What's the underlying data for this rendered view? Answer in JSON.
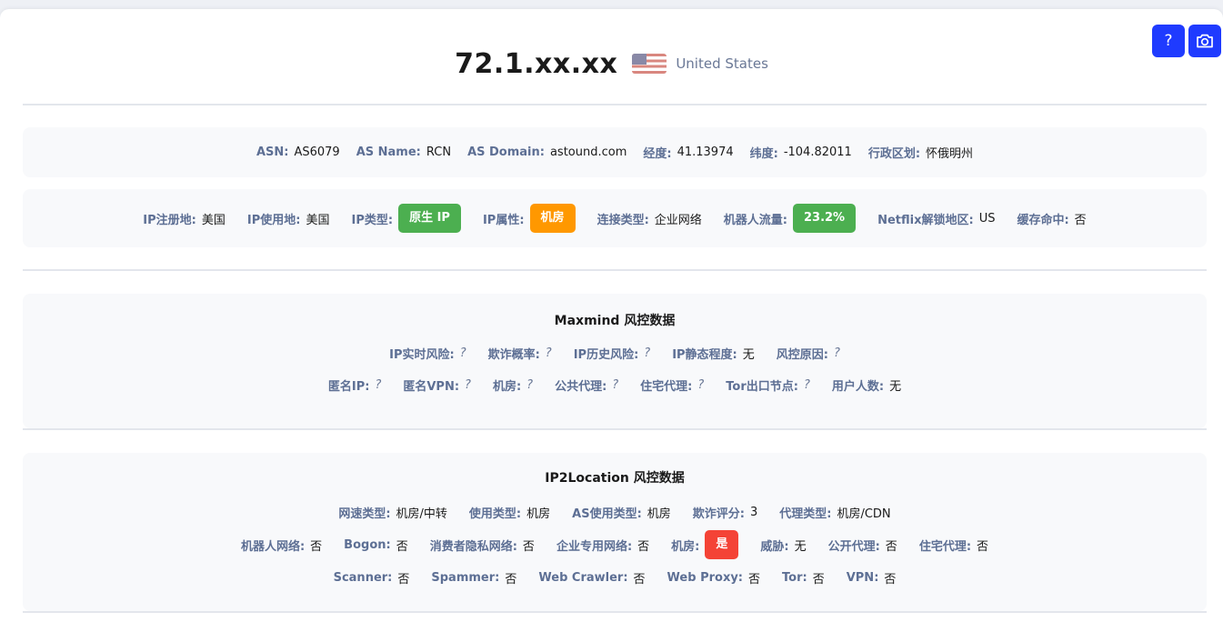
{
  "header": {
    "ip": "72.1.xx.xx",
    "country": "United States",
    "help_label": "?"
  },
  "summary_row1": [
    {
      "key": "ASN:",
      "value": "AS6079"
    },
    {
      "key": "AS Name:",
      "value": "RCN"
    },
    {
      "key": "AS Domain:",
      "value": "astound.com"
    },
    {
      "key": "经度:",
      "value": "41.13974"
    },
    {
      "key": "纬度:",
      "value": "-104.82011"
    },
    {
      "key": "行政区划:",
      "value": "怀俄明州"
    }
  ],
  "summary_row2": [
    {
      "key": "IP注册地:",
      "value": "美国"
    },
    {
      "key": "IP使用地:",
      "value": "美国"
    },
    {
      "key": "IP类型:",
      "badge": "原生 IP",
      "color": "#4caf50"
    },
    {
      "key": "IP属性:",
      "badge": "机房",
      "color": "#ff9800"
    },
    {
      "key": "连接类型:",
      "value": "企业网络"
    },
    {
      "key": "机器人流量:",
      "badge": "23.2%",
      "color": "#4caf50"
    },
    {
      "key": "Netflix解锁地区:",
      "value": "US"
    },
    {
      "key": "缓存命中:",
      "value": "否"
    }
  ],
  "maxmind": {
    "title": "Maxmind 风控数据",
    "row1": [
      {
        "key": "IP实时风险:",
        "value": "?"
      },
      {
        "key": "欺诈概率:",
        "value": "?"
      },
      {
        "key": "IP历史风险:",
        "value": "?"
      },
      {
        "key": "IP静态程度:",
        "value": "无"
      },
      {
        "key": "风控原因:",
        "value": "?"
      }
    ],
    "row2": [
      {
        "key": "匿名IP:",
        "value": "?"
      },
      {
        "key": "匿名VPN:",
        "value": "?"
      },
      {
        "key": "机房:",
        "value": "?"
      },
      {
        "key": "公共代理:",
        "value": "?"
      },
      {
        "key": "住宅代理:",
        "value": "?"
      },
      {
        "key": "Tor出口节点:",
        "value": "?"
      },
      {
        "key": "用户人数:",
        "value": "无"
      }
    ]
  },
  "ip2location": {
    "title": "IP2Location 风控数据",
    "row1": [
      {
        "key": "网速类型:",
        "value": "机房/中转"
      },
      {
        "key": "使用类型:",
        "value": "机房"
      },
      {
        "key": "AS使用类型:",
        "value": "机房"
      },
      {
        "key": "欺诈评分:",
        "value": "3"
      },
      {
        "key": "代理类型:",
        "value": "机房/CDN"
      }
    ],
    "row2": [
      {
        "key": "机器人网络:",
        "value": "否"
      },
      {
        "key": "Bogon:",
        "value": "否"
      },
      {
        "key": "消费者隐私网络:",
        "value": "否"
      },
      {
        "key": "企业专用网络:",
        "value": "否"
      },
      {
        "key": "机房:",
        "badge": "是",
        "color": "#f44336"
      },
      {
        "key": "威胁:",
        "value": "无"
      },
      {
        "key": "公开代理:",
        "value": "否"
      },
      {
        "key": "住宅代理:",
        "value": "否"
      }
    ],
    "row3": [
      {
        "key": "Scanner:",
        "value": "否"
      },
      {
        "key": "Spammer:",
        "value": "否"
      },
      {
        "key": "Web Crawler:",
        "value": "否"
      },
      {
        "key": "Web Proxy:",
        "value": "否"
      },
      {
        "key": "Tor:",
        "value": "否"
      },
      {
        "key": "VPN:",
        "value": "否"
      }
    ]
  }
}
